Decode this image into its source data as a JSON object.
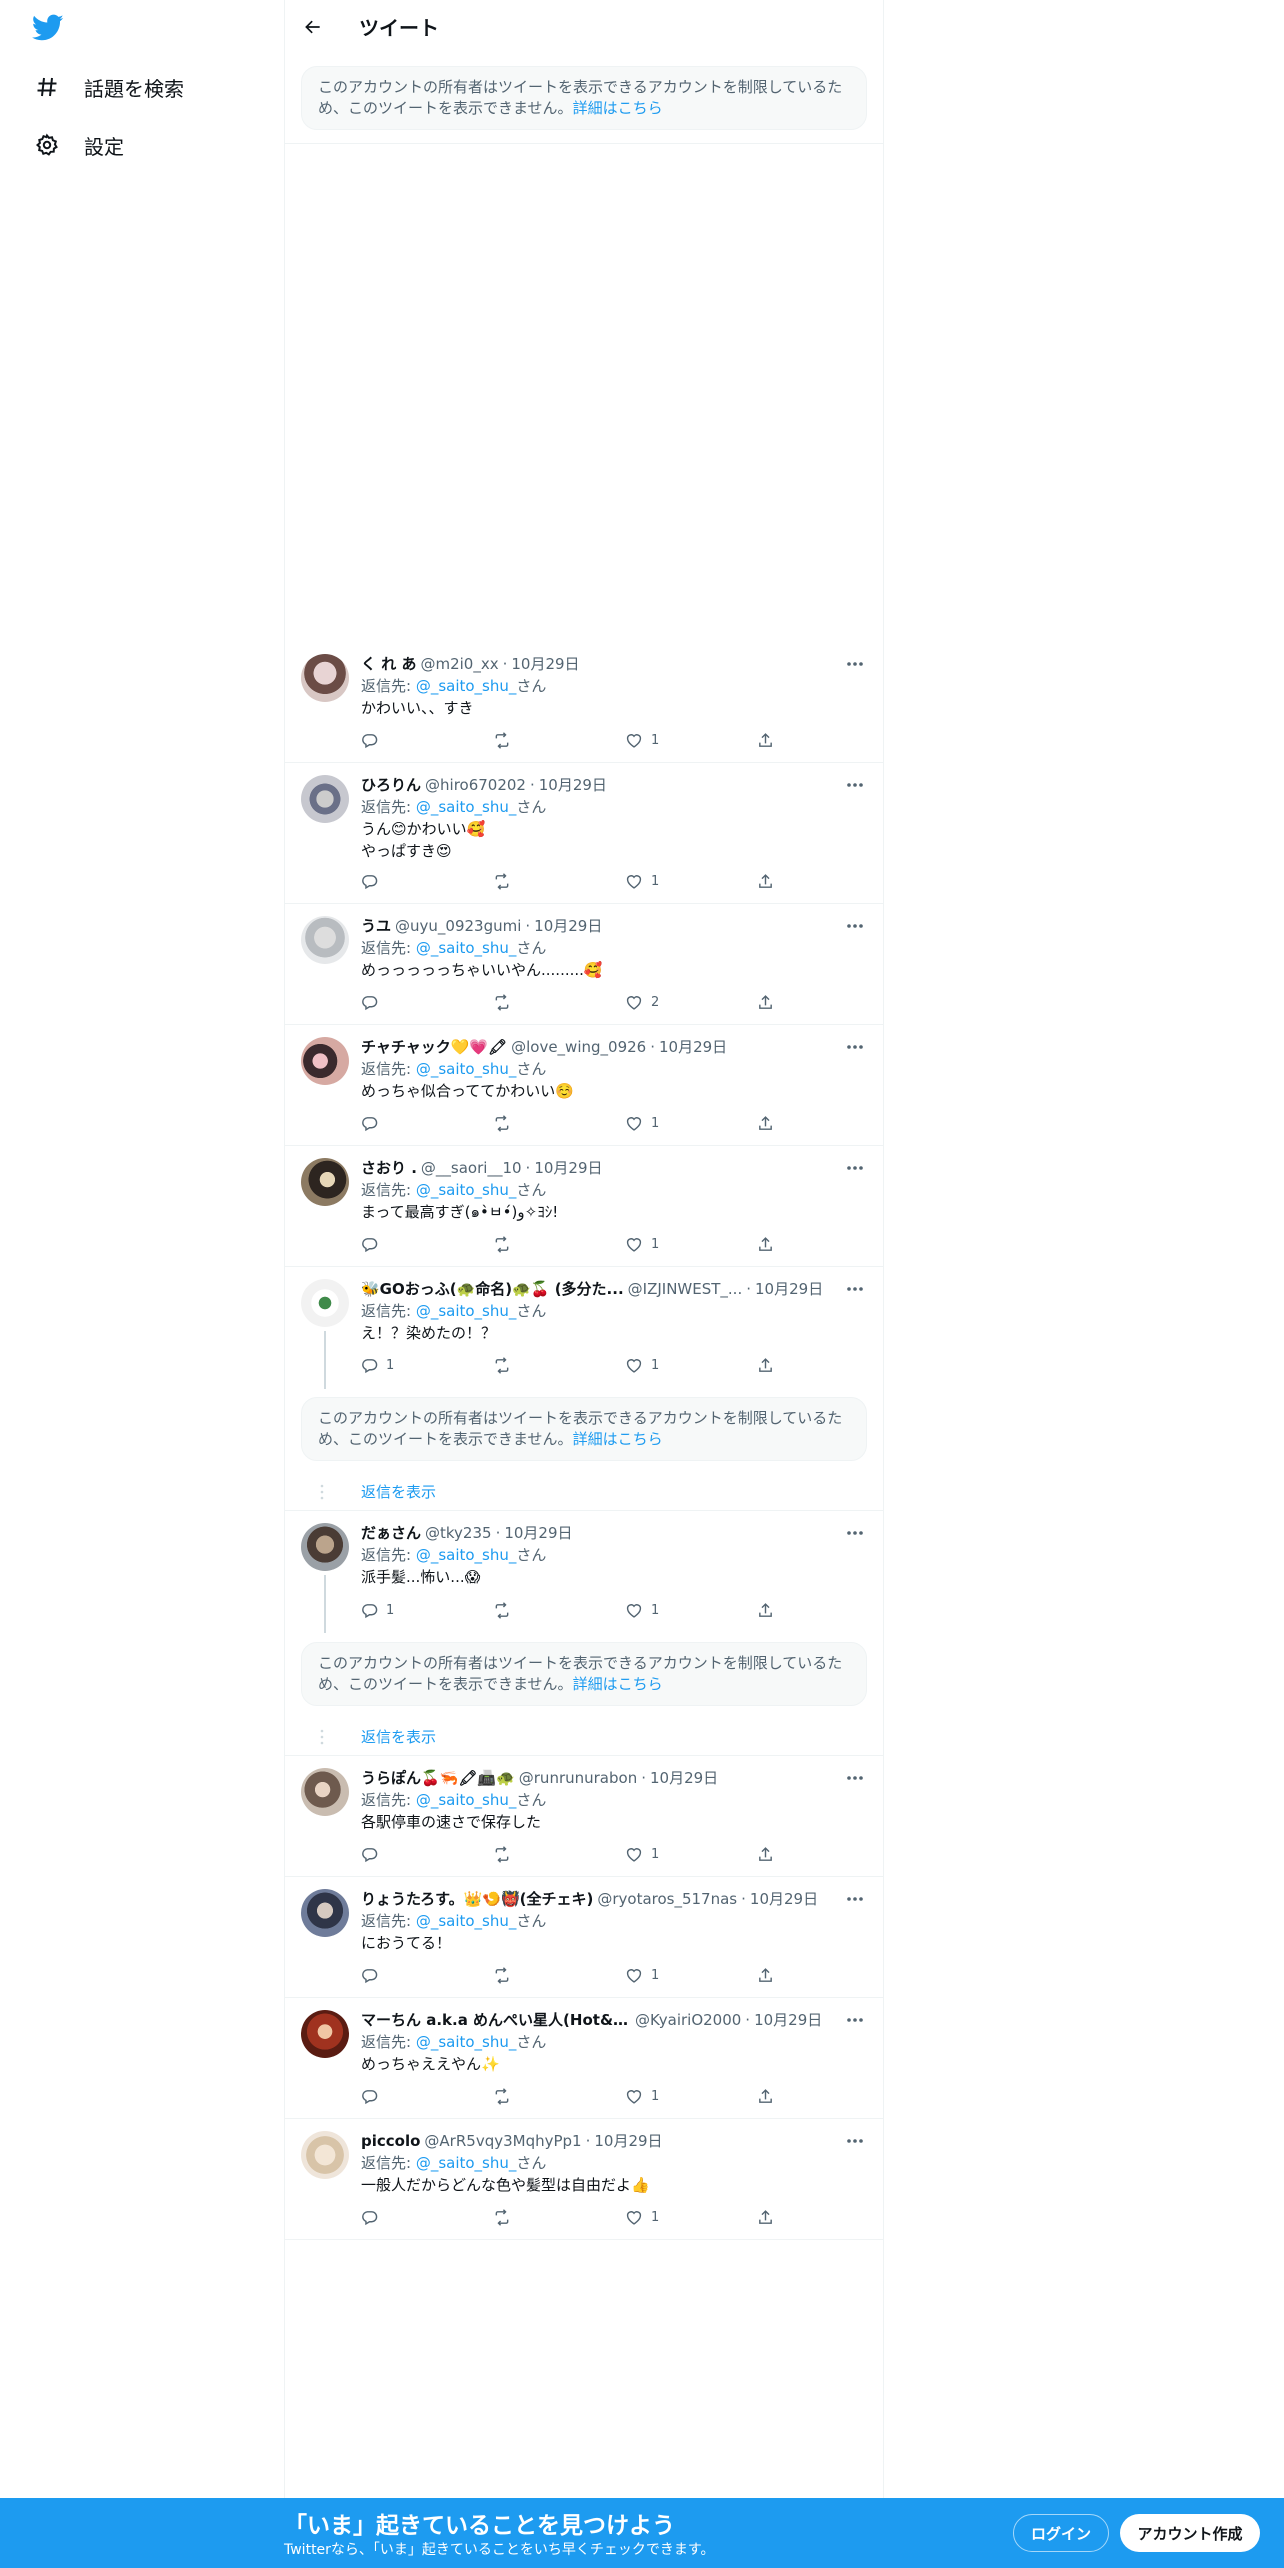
{
  "sidebar": {
    "logo": "twitter-bird-icon",
    "items": [
      {
        "label": "話題を検索",
        "icon": "hashtag-icon"
      },
      {
        "label": "設定",
        "icon": "gear-icon"
      }
    ]
  },
  "header": {
    "title": "ツイート"
  },
  "restricted_notice": {
    "text": "このアカウントの所有者はツイートを表示できるアカウントを制限しているため、このツイートを表示できません。",
    "link": "詳細はこちら"
  },
  "reply_prefix": "返信先: ",
  "reply_suffix": "さん",
  "show_replies_label": "返信を表示",
  "tweets": [
    {
      "name": "く れ あ",
      "handle": "@m2i0_xx",
      "date": "10月29日",
      "reply_to": "@_saito_shu_",
      "text": "かわいい、、すき",
      "replies": "",
      "retweets": "",
      "likes": "1"
    },
    {
      "name": "ひろりん",
      "handle": "@hiro670202",
      "date": "10月29日",
      "reply_to": "@_saito_shu_",
      "text": "うん😊かわいい🥰",
      "text2": "やっぱすき😍",
      "replies": "",
      "retweets": "",
      "likes": "1"
    },
    {
      "name": "うユ",
      "handle": "@uyu_0923gumi",
      "date": "10月29日",
      "reply_to": "@_saito_shu_",
      "text": "めっっっっっちゃいいやん.........🥰",
      "replies": "",
      "retweets": "",
      "likes": "2"
    },
    {
      "name": "チャチャック💛💗🖍",
      "handle": "@love_wing_0926",
      "date": "10月29日",
      "reply_to": "@_saito_shu_",
      "text": "めっちゃ似合っててかわいい☺️",
      "replies": "",
      "retweets": "",
      "likes": "1"
    },
    {
      "name": "さおり .",
      "handle": "@__saori__10",
      "date": "10月29日",
      "reply_to": "@_saito_shu_",
      "text": "まって最高すぎ(๑•̀ㅂ•́)و✧ﾖｼ!",
      "replies": "",
      "retweets": "",
      "likes": "1"
    },
    {
      "name": "🐝GOおっふ(🐢命名)🐢🍒 (多分た...",
      "handle": "@IZJINWEST_...",
      "date": "10月29日",
      "reply_to": "@_saito_shu_",
      "text": "え！？染めたの！？",
      "replies": "1",
      "retweets": "",
      "likes": "1"
    },
    {
      "name": "だぁさん",
      "handle": "@tky235",
      "date": "10月29日",
      "reply_to": "@_saito_shu_",
      "text": "派手髪...怖い...😱",
      "replies": "1",
      "retweets": "",
      "likes": "1"
    },
    {
      "name": "うらぽん🍒🦐🖍📠🐢",
      "handle": "@runrunurabon",
      "date": "10月29日",
      "reply_to": "@_saito_shu_",
      "text": "各駅停車の速さで保存した",
      "replies": "",
      "retweets": "",
      "likes": "1"
    },
    {
      "name": "りょうたろす。👑🍤👹(全チェキ)",
      "handle": "@ryotaros_517nas",
      "date": "10月29日",
      "reply_to": "@_saito_shu_",
      "text": "におうてる！",
      "replies": "",
      "retweets": "",
      "likes": "1"
    },
    {
      "name": "マーちん a.k.a めんぺい星人(Hot&Cool)",
      "handle": "@KyairiO2000",
      "date": "10月29日",
      "reply_to": "@_saito_shu_",
      "text": "めっちゃええやん✨",
      "replies": "",
      "retweets": "",
      "likes": "1"
    },
    {
      "name": "piccolo",
      "handle": "@ArR5vqy3MqhyPp1",
      "date": "10月29日",
      "reply_to": "@_saito_shu_",
      "text": "一般人だからどんな色や髪型は自由だよ👍",
      "replies": "",
      "retweets": "",
      "likes": "1"
    }
  ],
  "bottom_bar": {
    "title": "「いま」起きていることを見つけよう",
    "subtitle": "Twitterなら、「いま」起きていることをいち早くチェックできます。",
    "login": "ログイン",
    "signup": "アカウント作成"
  },
  "colors": {
    "accent": "#1d9bf0",
    "text": "#0f1419",
    "secondary": "#536471",
    "border": "#eff3f4"
  }
}
